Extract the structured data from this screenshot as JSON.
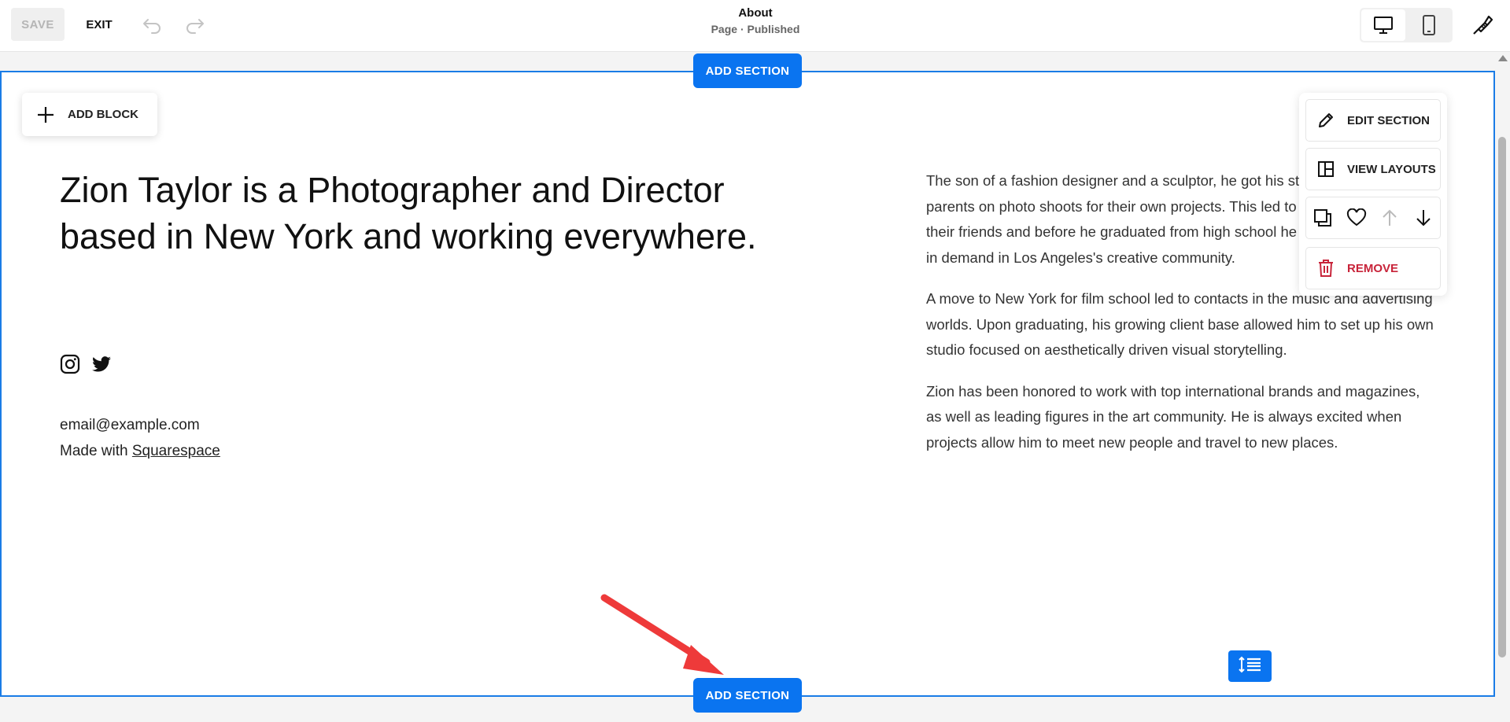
{
  "toolbar": {
    "save_label": "SAVE",
    "exit_label": "EXIT",
    "page_title": "About",
    "page_status": "Page · Published"
  },
  "section": {
    "add_section_top": "ADD SECTION",
    "add_section_bottom": "ADD SECTION",
    "add_block": "ADD BLOCK",
    "headline": "Zion Taylor is a Photographer and Director based in New York and working everywhere.",
    "email": "email@example.com",
    "made_with": "Made with ",
    "made_with_link": "Squarespace",
    "bio": [
      "The son of a fashion designer and a sculptor, he got his start assisting his parents on photo shoots for their own projects. This led to commissions from their friends and before he graduated from high school he was already steadily in demand in Los Angeles's creative community.",
      "A move to New York for film school led to contacts in the music and advertising worlds. Upon graduating, his growing client base allowed him to set up his own studio focused on aesthetically driven visual storytelling.",
      "Zion has been honored to work with top international brands and magazines, as well as leading figures in the art community. He is always excited when projects allow him to meet new people and travel to new places."
    ]
  },
  "section_menu": {
    "edit_section": "EDIT SECTION",
    "view_layouts": "VIEW LAYOUTS",
    "remove": "REMOVE"
  },
  "colors": {
    "accent": "#0a74f0",
    "selection_border": "#1a7ce6",
    "remove": "#c8243a",
    "annotation_arrow": "#ee3a3a"
  }
}
